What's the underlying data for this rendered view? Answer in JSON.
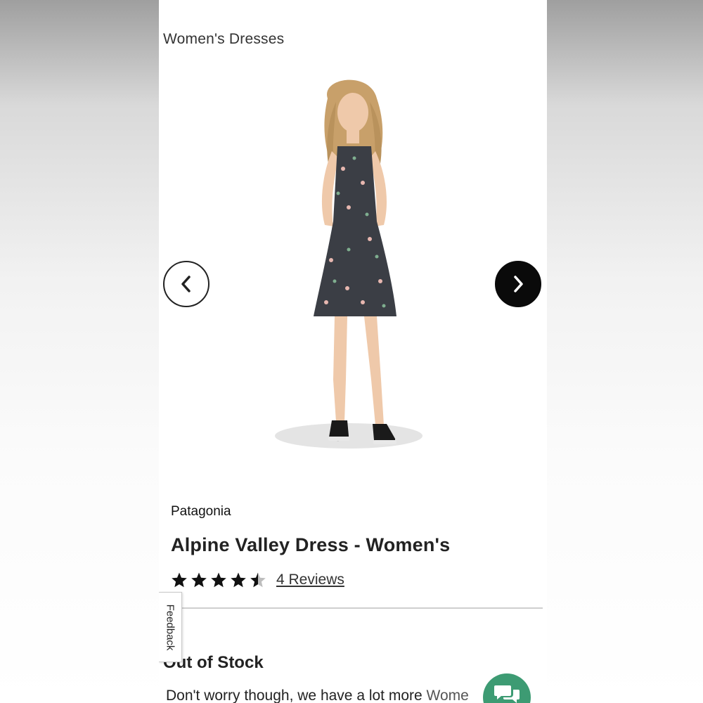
{
  "breadcrumb": {
    "label": "Women's Dresses"
  },
  "carousel": {
    "prev_icon": "chevron-left-icon",
    "next_icon": "chevron-right-icon"
  },
  "product": {
    "brand": "Patagonia",
    "title": "Alpine Valley Dress - Women's",
    "rating": 4.5,
    "rating_max": 5,
    "reviews_label": "4 Reviews",
    "image_description_color": "#3b3e45"
  },
  "stock": {
    "heading": "Out of Stock",
    "body_start": "Don't worry though, we have a lot more ",
    "body_link": "Wome"
  },
  "feedback": {
    "label": "Feedback"
  },
  "chat": {
    "icon": "chat-bubbles-icon",
    "color": "#3d9b73"
  }
}
